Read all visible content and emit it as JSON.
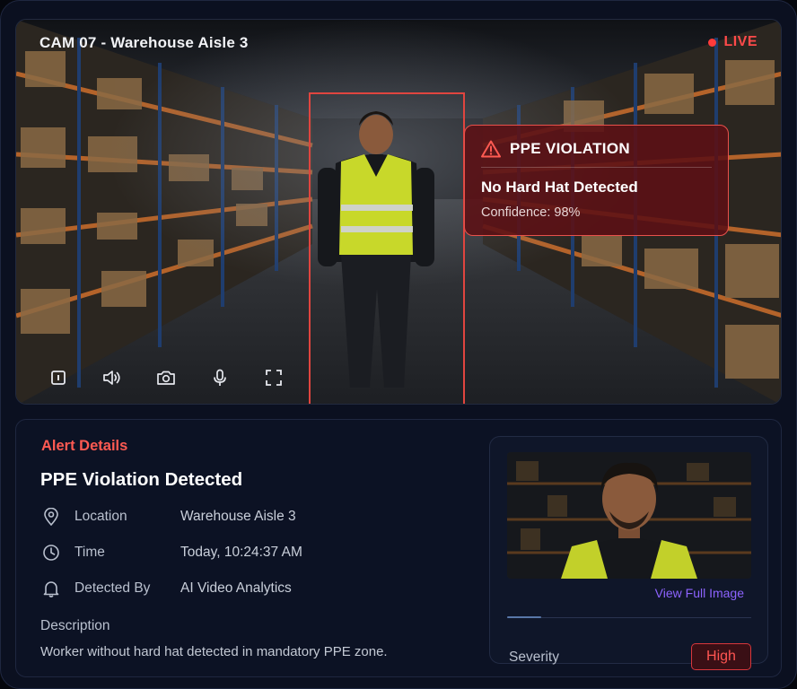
{
  "camera": {
    "title": "CAM 07 - Warehouse Aisle 3",
    "live_label": "LIVE"
  },
  "violation": {
    "title": "PPE VIOLATION",
    "message": "No Hard Hat Detected",
    "confidence": "Confidence: 98%"
  },
  "controls": [
    {
      "icon": "pause-icon"
    },
    {
      "icon": "volume-icon"
    },
    {
      "icon": "camera-icon"
    },
    {
      "icon": "microphone-icon"
    },
    {
      "icon": "fullscreen-icon"
    }
  ],
  "alert": {
    "section_label": "Alert Details",
    "title": "PPE Violation Detected",
    "fields": [
      {
        "icon": "location-pin-icon",
        "key": "Location",
        "value": "Warehouse Aisle 3"
      },
      {
        "icon": "clock-icon",
        "key": "Time",
        "value": "Today, 10:24:37 AM"
      },
      {
        "icon": "bell-icon",
        "key": "Detected By",
        "value": "AI Video Analytics"
      }
    ],
    "description_label": "Description",
    "description": "Worker without hard hat detected in mandatory PPE zone."
  },
  "snapshot": {
    "view_link": "View Full Image",
    "severity_label": "Severity",
    "severity_value": "High",
    "severity_level": 0.14
  },
  "colors": {
    "accent_red": "#ff4a4a",
    "link_purple": "#8d63ff",
    "panel_bg": "#0c1224"
  }
}
